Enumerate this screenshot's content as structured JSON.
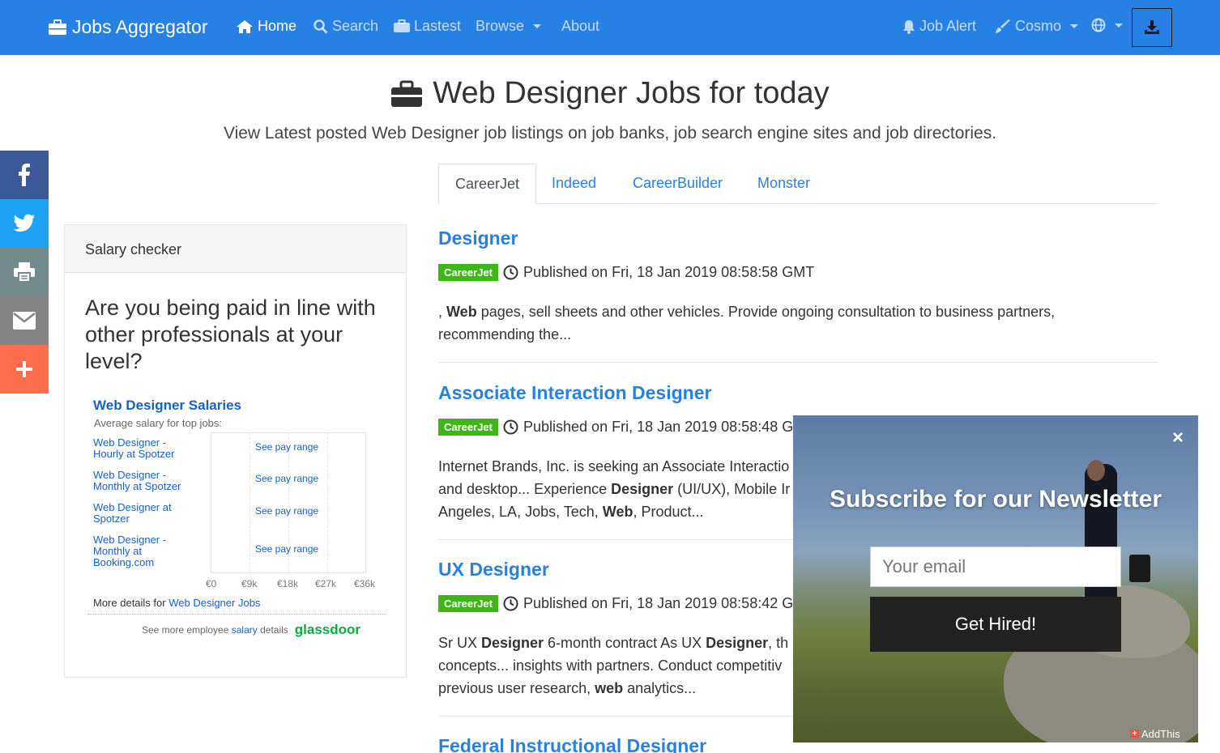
{
  "navbar": {
    "brand": "Jobs Aggregator",
    "home": "Home",
    "search": "Search",
    "latest": "Lastest",
    "browse": "Browse",
    "about": "About",
    "job_alert": "Job Alert",
    "theme": "Cosmo"
  },
  "header": {
    "title": "Web Designer Jobs for today",
    "lead": "View Latest posted Web Designer job listings on job banks, job search engine sites and job directories."
  },
  "share_bar": {
    "items": [
      "facebook-icon",
      "twitter-icon",
      "print-icon",
      "email-icon",
      "plus-icon"
    ],
    "colors": [
      "#3b5998",
      "#1da1f2",
      "#738a8d",
      "#848484",
      "#fe6d4c"
    ]
  },
  "salary_card": {
    "header": "Salary checker",
    "question": "Are you being paid in line with other professionals at your level?",
    "widget": {
      "title": "Web Designer Salaries",
      "subtitle": "Average salary for top jobs:",
      "rows": [
        {
          "label": "Web Designer - Hourly at Spotzer",
          "pay": "See pay range"
        },
        {
          "label": "Web Designer - Monthly at Spotzer",
          "pay": "See pay range"
        },
        {
          "label": "Web Designer at Spotzer",
          "pay": "See pay range"
        },
        {
          "label": "Web Designer - Monthly at Booking.com",
          "pay": "See pay range"
        }
      ],
      "axis": [
        "€0",
        "€9k",
        "€18k",
        "€27k",
        "€36k"
      ],
      "more_prefix": "More details for",
      "more_link": "Web Designer Jobs",
      "footer_prefix": "See more employee",
      "footer_link": "salary",
      "footer_suffix": "details",
      "logo": "glassdoor"
    }
  },
  "tabs": [
    "CareerJet",
    "Indeed",
    "CareerBuilder",
    "Monster"
  ],
  "jobs": [
    {
      "title": "Designer",
      "source": "CareerJet",
      "published": "Published on Fri, 18 Jan 2019 08:58:58 GMT",
      "desc_html": ", <b>Web</b> pages, sell sheets and other vehicles. Provide ongoing consultation to business partners, recommending the..."
    },
    {
      "title": "Associate Interaction Designer",
      "source": "CareerJet",
      "published": "Published on Fri, 18 Jan 2019 08:58:48 G",
      "desc_html": "Internet Brands, Inc. is seeking an Associate Interactio<br>and desktop... Experience <b>Designer</b> (UI/UX), Mobile Ir<br>Angeles, LA, Jobs, Tech, <b>Web</b>, Product..."
    },
    {
      "title": "UX Designer",
      "source": "CareerJet",
      "published": "Published on Fri, 18 Jan 2019 08:58:42 G",
      "desc_html": "Sr UX <b>Designer</b> 6-month contract As UX <b>Designer</b>, th<br>concepts... insights with partners. Conduct competitiv<br>previous user research, <b>web</b> analytics..."
    },
    {
      "title": "Federal Instructional Designer"
    }
  ],
  "popup": {
    "close": "×",
    "title": "Subscribe for our Newsletter",
    "placeholder": "Your email",
    "button": "Get Hired!",
    "addthis": "AddThis"
  },
  "colors": {
    "primary": "#2780e3",
    "success": "#3fb618",
    "glassdoor": "#0caa41"
  }
}
